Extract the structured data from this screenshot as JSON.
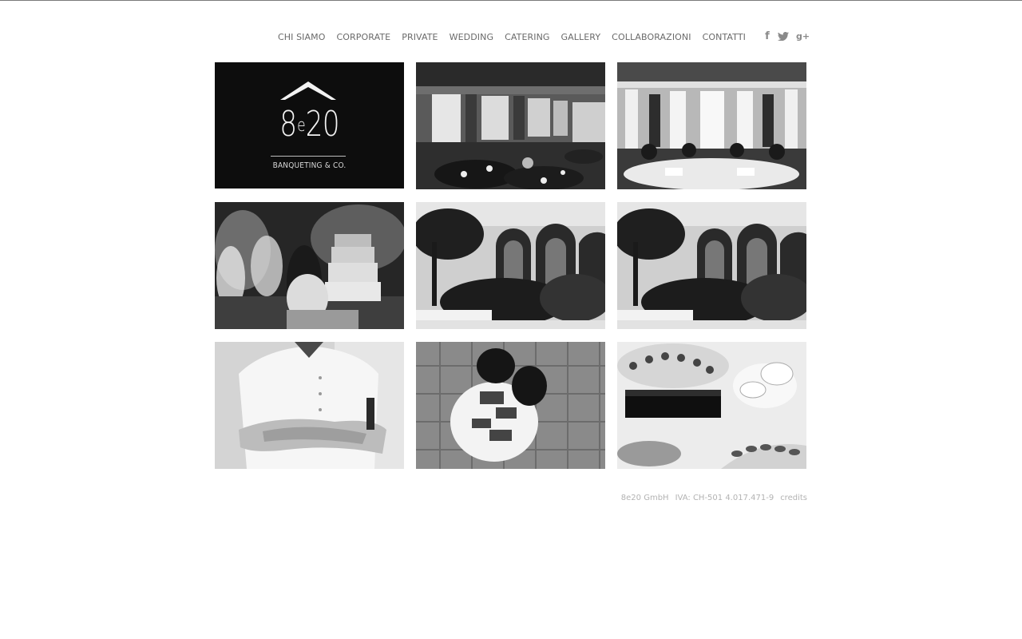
{
  "nav": {
    "items": [
      {
        "label": "CHI SIAMO"
      },
      {
        "label": "CORPORATE"
      },
      {
        "label": "PRIVATE"
      },
      {
        "label": "WEDDING"
      },
      {
        "label": "CATERING"
      },
      {
        "label": "GALLERY"
      },
      {
        "label": "COLLABORAZIONI"
      },
      {
        "label": "CONTATTI"
      }
    ]
  },
  "social": {
    "facebook_glyph": "f",
    "google_glyph": "g+",
    "icons": [
      "facebook-icon",
      "twitter-icon",
      "google-plus-icon"
    ]
  },
  "logo": {
    "mark_main_left": "8",
    "mark_small": "e",
    "mark_main_right": "20",
    "subtitle": "BANQUETING & CO."
  },
  "gallery": {
    "tiles": [
      "logo",
      "banquet-hall-windows",
      "ornate-ballroom",
      "couple-fireworks-cake",
      "arched-courtyard-garden",
      "arched-courtyard-garden",
      "chef-crossed-arms",
      "waiters-serving-table",
      "buffet-flowers"
    ]
  },
  "footer": {
    "company": "8e20 GmbH",
    "vat": "IVA: CH-501 4.017.471-9",
    "credits": "credits"
  },
  "colors": {
    "background": "#ffffff",
    "nav_text": "#6a6a6a",
    "footer_text": "#b3b3b3",
    "logo_bg": "#0d0d0d"
  }
}
